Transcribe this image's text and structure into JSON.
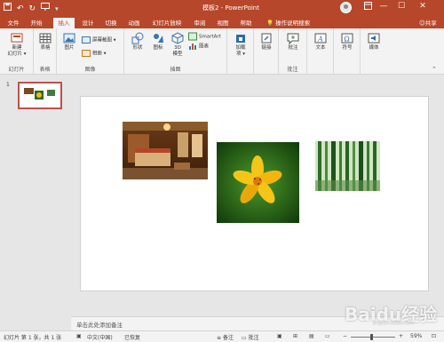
{
  "titlebar": {
    "title": "模板2 - PowerPoint",
    "quick_access": [
      "save-icon",
      "undo-icon",
      "redo-icon",
      "present-icon",
      "customize-icon"
    ],
    "window_buttons": [
      "restore-ribbon-icon",
      "minimize-icon",
      "maximize-icon",
      "close-icon"
    ]
  },
  "tabs": [
    "文件",
    "开始",
    "插入",
    "设计",
    "切换",
    "动画",
    "幻灯片放映",
    "审阅",
    "视图",
    "帮助"
  ],
  "active_tab": "插入",
  "search_label": "操作说明搜索",
  "share_label": "共享",
  "ribbon": {
    "groups": {
      "slides": {
        "label": "幻灯片",
        "new_slide": "新建\n幻灯片 ▾"
      },
      "tables": {
        "label": "表格",
        "table": "表格"
      },
      "images": {
        "label": "图像",
        "pictures": "图片",
        "screenshot": "屏幕截图 ▾",
        "album": "相册 ▾"
      },
      "illustrations": {
        "label": "插图",
        "shapes": "形状",
        "icons": "图标",
        "model3d": "3D\n模型",
        "smartart": "SmartArt",
        "chart": "图表"
      },
      "addins": {
        "label": "",
        "addin": "加载\n项 ▾"
      },
      "links": {
        "label": "",
        "link": "链接"
      },
      "comments": {
        "label": "批注",
        "comment": "批注"
      },
      "text": {
        "label": "",
        "text": "文本"
      },
      "symbols": {
        "label": "",
        "symbol": "符号"
      },
      "media": {
        "label": "",
        "media": "媒体"
      }
    }
  },
  "thumbnail": {
    "slide_number": "1"
  },
  "notes_placeholder": "单击此处添加备注",
  "statusbar": {
    "slide_info": "幻灯片 第 1 张，共 1 张",
    "language": "中文(中国)",
    "recovered": "已恢复",
    "notes_btn": "备注",
    "comments_btn": "批注",
    "zoom": "59%"
  },
  "colors": {
    "accent": "#b7472a",
    "ribbon_bg": "#f3f3f3",
    "window_bg": "#e6e6e6",
    "thumb_border": "#c0504d"
  },
  "watermark": {
    "text": "Baidu经验",
    "sub": "jingyan.baidu.com"
  }
}
